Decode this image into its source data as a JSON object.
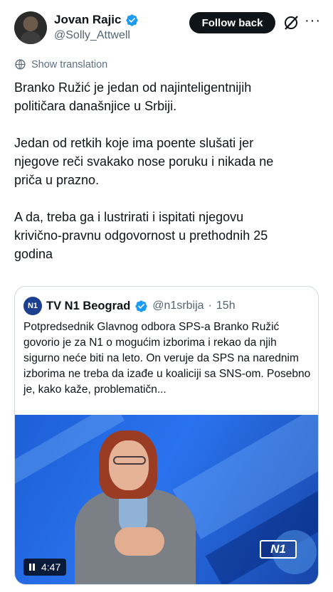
{
  "author": {
    "name": "Jovan Rajic",
    "handle": "@Solly_Attwell",
    "follow_label": "Follow back"
  },
  "icons": {
    "verified": "verified-badge-icon",
    "grok": "grok-icon",
    "more": "more-icon",
    "translate": "globe-icon"
  },
  "translate_label": "Show translation",
  "post": {
    "paragraphs": [
      "Branko Ružić je jedan od najinteligentnijih\npolitičara današnjice u Srbiji.",
      "Jedan od retkih koje ima poente slušati jer\nnjegove reči svakako nose poruku i nikada ne\npriča u prazno.",
      "A da, treba ga i lustrirati i ispitati njegovu\nkrivično-pravnu odgovornost u prethodnih 25\ngodina"
    ]
  },
  "quote": {
    "logo_text": "N1",
    "name": "TV N1 Beograd",
    "handle": "@n1srbija",
    "separator": "·",
    "time": "15h",
    "text": "Potpredsednik Glavnog odbora SPS-a Branko Ružić govorio je za N1 o mogućim izborima i rekao da njih sigurno neće biti na leto. On veruje da SPS na narednim izborima ne treba da izađe u koaliciji sa SNS-om. Posebno je, kako kaže, problematičn...",
    "video": {
      "duration": "4:47",
      "watermark": "N1"
    }
  },
  "colors": {
    "verified": "#1d9bf0",
    "follow_bg": "#0f1419",
    "secondary_text": "#536471",
    "border": "#cfd9de",
    "n1_blue": "#1c3f8f"
  }
}
